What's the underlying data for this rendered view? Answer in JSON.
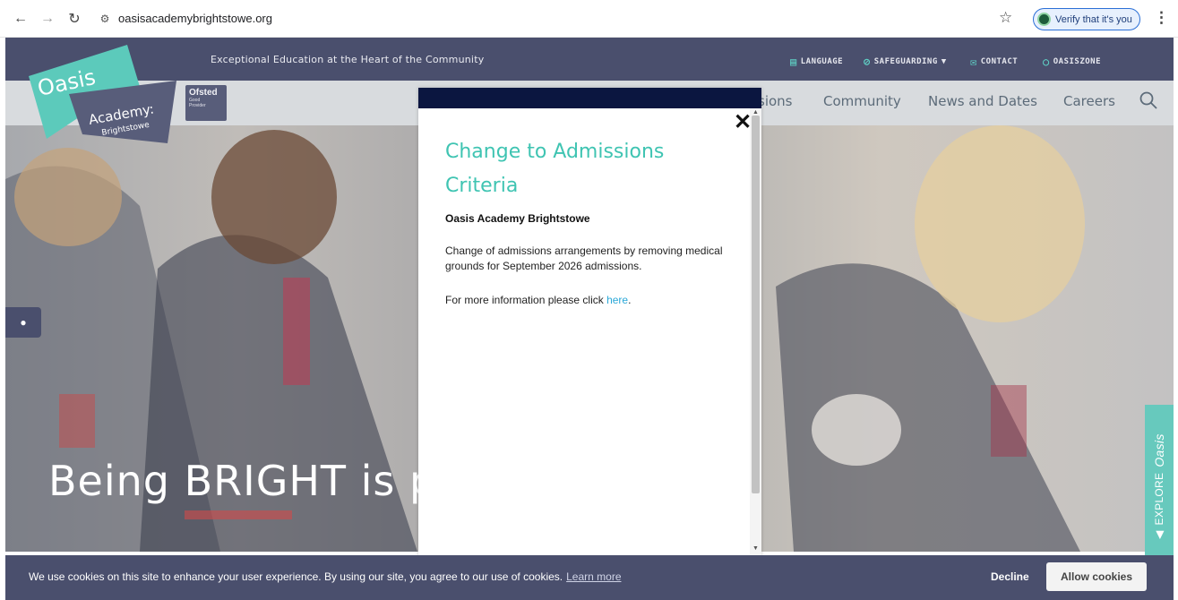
{
  "browser": {
    "url": "oasisacademybrightstowe.org",
    "verify_label": "Verify that it's you"
  },
  "site": {
    "tagline": "Exceptional Education at the Heart of the Community",
    "utility_links": [
      {
        "label": "LANGUAGE",
        "icon": "language-icon"
      },
      {
        "label": "SAFEGUARDING",
        "icon": "safeguarding-icon"
      },
      {
        "label": "CONTACT",
        "icon": "mail-icon"
      },
      {
        "label": "OASISZONE",
        "icon": "circle-icon"
      }
    ],
    "nav": [
      "sions",
      "Community",
      "News and Dates",
      "Careers"
    ],
    "logo": {
      "line1": "Oasis",
      "line2": "Academy:",
      "line3": "Brightstowe"
    },
    "ofsted": {
      "title": "Ofsted",
      "sub1": "Good",
      "sub2": "Provider"
    },
    "hero_headline": "Being BRIGHT is p",
    "explore_label": "EXPLORE",
    "explore_brand": "Oasis"
  },
  "modal": {
    "title": "Change to Admissions Criteria",
    "subtitle": "Oasis Academy Brightstowe",
    "body": "Change of admissions arrangements by removing medical grounds for September 2026 admissions.",
    "more_prefix": "For more information please click ",
    "more_link": "here",
    "more_suffix": "."
  },
  "cookies": {
    "text": "We use cookies on this site to enhance your user experience. By using our site, you agree to our use of cookies.",
    "learn_more": "Learn more",
    "decline": "Decline",
    "allow": "Allow cookies"
  },
  "colors": {
    "brand_dark": "#4a4f6d",
    "accent_teal": "#3fc4b2",
    "modal_header": "#0b1640"
  }
}
